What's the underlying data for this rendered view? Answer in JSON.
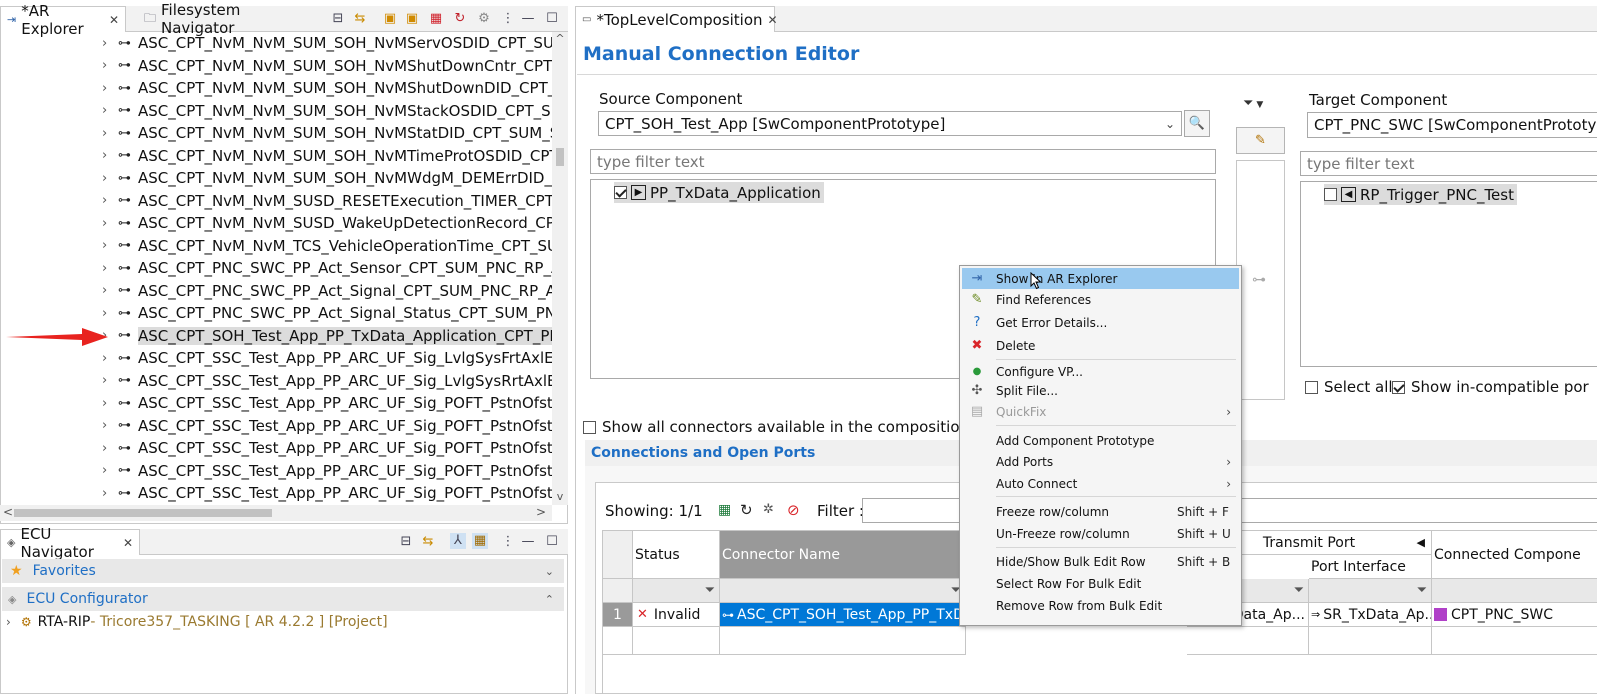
{
  "left_top_tabs": {
    "ar_explorer": "*AR Explorer",
    "filesystem_navigator": "Filesystem Navigator"
  },
  "tree_items": [
    "ASC_CPT_NvM_NvM_SUM_SOH_NvMServOSDID_CPT_SUM_SOH",
    "ASC_CPT_NvM_NvM_SUM_SOH_NvMShutDownCntr_CPT_SUM_S",
    "ASC_CPT_NvM_NvM_SUM_SOH_NvMShutDownDID_CPT_SUM_S",
    "ASC_CPT_NvM_NvM_SUM_SOH_NvMStackOSDID_CPT_SUM_SOH",
    "ASC_CPT_NvM_NvM_SUM_SOH_NvMStatDID_CPT_SUM_SOH_RP",
    "ASC_CPT_NvM_NvM_SUM_SOH_NvMTimeProtOSDID_CPT_SUM_",
    "ASC_CPT_NvM_NvM_SUM_SOH_NvMWdgM_DEMErrDID_CPT_SU",
    "ASC_CPT_NvM_NvM_SUSD_RESETExecution_TIMER_CPT_SUSD_F",
    "ASC_CPT_NvM_NvM_SUSD_WakeUpDetectionRecord_CPT_SUSD",
    "ASC_CPT_NvM_NvM_TCS_VehicleOperationTime_CPT_SUM_TCS_",
    "ASC_CPT_PNC_SWC_PP_Act_Sensor_CPT_SUM_PNC_RP_Act_Sens",
    "ASC_CPT_PNC_SWC_PP_Act_Signal_CPT_SUM_PNC_RP_Act_Signa",
    "ASC_CPT_PNC_SWC_PP_Act_Signal_Status_CPT_SUM_PNC_RP_Ac",
    "ASC_CPT_SOH_Test_App_PP_TxData_Application_CPT_PNC_SWC",
    "ASC_CPT_SSC_Test_App_PP_ARC_UF_Sig_LvlgSysFrtAxlEstdLd_CP",
    "ASC_CPT_SSC_Test_App_PP_ARC_UF_Sig_LvlgSysRrtAxlEstdLd_CF",
    "ASC_CPT_SSC_Test_App_PP_ARC_UF_Sig_POFT_PstnOfstFrmTrmL",
    "ASC_CPT_SSC_Test_App_PP_ARC_UF_Sig_POFT_PstnOfstFrmTrmL",
    "ASC_CPT_SSC_Test_App_PP_ARC_UF_Sig_POFT_PstnOfstFrmTrmL",
    "ASC_CPT_SSC_Test_App_PP_ARC_UF_Sig_POFT_PstnOfstFrmTrmL",
    "ASC_CPT_SSC_Test_App_PP_ARC_UF_Sig_POFT_PstnOfstFrmTrmR"
  ],
  "ecu_navigator": {
    "tab": "ECU Navigator",
    "favorites": "Favorites",
    "ecu_configurator": "ECU Configurator",
    "project_name": "RTA-RIP",
    "project_detail": " - Tricore357_TASKING [ AR 4.2.2 ] [Project]"
  },
  "editor": {
    "tab": "*TopLevelComposition",
    "title": "Manual Connection Editor",
    "source_label": "Source Component",
    "source_value": "CPT_SOH_Test_App   [SwComponentPrototype]",
    "source_filter_placeholder": "type filter text",
    "source_port": "PP_TxData_Application",
    "target_label": "Target Component",
    "target_value": "CPT_PNC_SWC   [SwComponentPrototy",
    "target_filter_placeholder": "type filter text",
    "target_port": "RP_Trigger_PNC_Test",
    "select_all": "Select all",
    "show_incompatible": "Show in-compatible por",
    "show_all_connectors": "Show all connectors available in the composition",
    "section_title": "Connections and Open Ports",
    "showing": "Showing: 1/1",
    "filter_label": "Filter :"
  },
  "table": {
    "headers": {
      "status": "Status",
      "connector_name": "Connector Name",
      "transmit_port": "Transmit Port",
      "port_interface": "Port Interface",
      "connected_component": "Connected Compone"
    },
    "row": {
      "num": "1",
      "status": "Invalid",
      "connector": "ASC_CPT_SOH_Test_App_PP_TxD...",
      "transmit_port": "Data_Ap...",
      "port_interface": "SR_TxData_Ap...",
      "connected_component": "CPT_PNC_SWC"
    }
  },
  "context_menu": [
    {
      "label": "Show In AR Explorer",
      "icon": "arrow-right-icon",
      "highlight": true
    },
    {
      "label": "Find References",
      "icon": "references-icon"
    },
    {
      "label": "Get Error Details...",
      "icon": "help-icon"
    },
    {
      "label": "Delete",
      "icon": "delete-icon"
    },
    {
      "label": "Configure VP...",
      "icon": "vp-icon"
    },
    {
      "label": "Split File...",
      "icon": "split-icon"
    },
    {
      "label": "QuickFix",
      "icon": "quickfix-icon",
      "disabled": true
    },
    {
      "label": "Add Component Prototype"
    },
    {
      "label": "Add Ports"
    },
    {
      "label": "Auto Connect"
    },
    {
      "label": "Freeze row/column",
      "shortcut": "Shift + F"
    },
    {
      "label": "Un-Freeze row/column",
      "shortcut": "Shift + U"
    },
    {
      "label": "Hide/Show Bulk Edit Row",
      "shortcut": "Shift + B"
    },
    {
      "label": "Select Row For Bulk Edit"
    },
    {
      "label": "Remove Row from Bulk Edit"
    }
  ],
  "colors": {
    "title_blue": "#1f6fc5",
    "menu_highlight": "#99c9ef",
    "selection_blue": "#0078d7",
    "error_red": "#d9252a",
    "arrow_red": "#e8231f"
  }
}
